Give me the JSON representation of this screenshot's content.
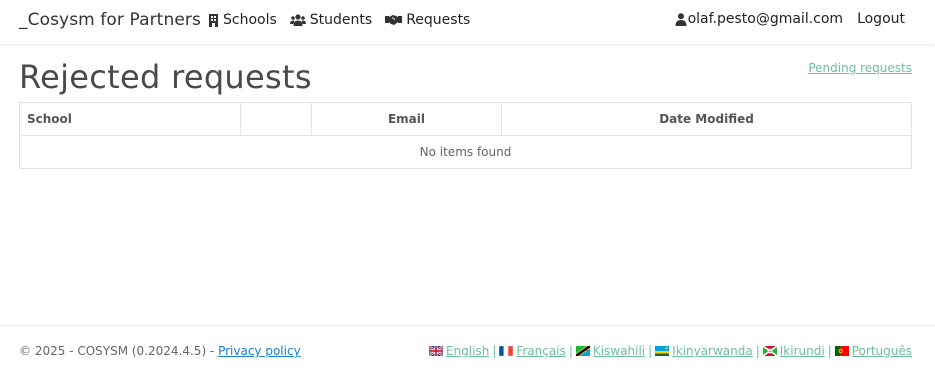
{
  "nav": {
    "brand": "_Cosysm for Partners",
    "links": [
      {
        "label": "Schools",
        "icon": "building-icon"
      },
      {
        "label": "Students",
        "icon": "users-icon"
      },
      {
        "label": "Requests",
        "icon": "handshake-icon"
      }
    ],
    "user_email": "olaf.pesto@gmail.com",
    "logout_label": "Logout"
  },
  "main": {
    "title": "Rejected requests",
    "pending_link": "Pending requests",
    "table": {
      "headers": [
        "School",
        "",
        "Email",
        "Date Modified"
      ],
      "empty_text": "No items found"
    }
  },
  "footer": {
    "copyright": "© 2025 - COSYSM (0.2024.4.5) - ",
    "privacy_label": "Privacy policy",
    "languages": [
      "English",
      "Français",
      "Kiswahili",
      "Ikinyarwanda",
      "Ikirundi",
      "Português"
    ]
  },
  "colors": {
    "accent_link": "#6dbf9b",
    "privacy_link": "#1a7fcf"
  }
}
